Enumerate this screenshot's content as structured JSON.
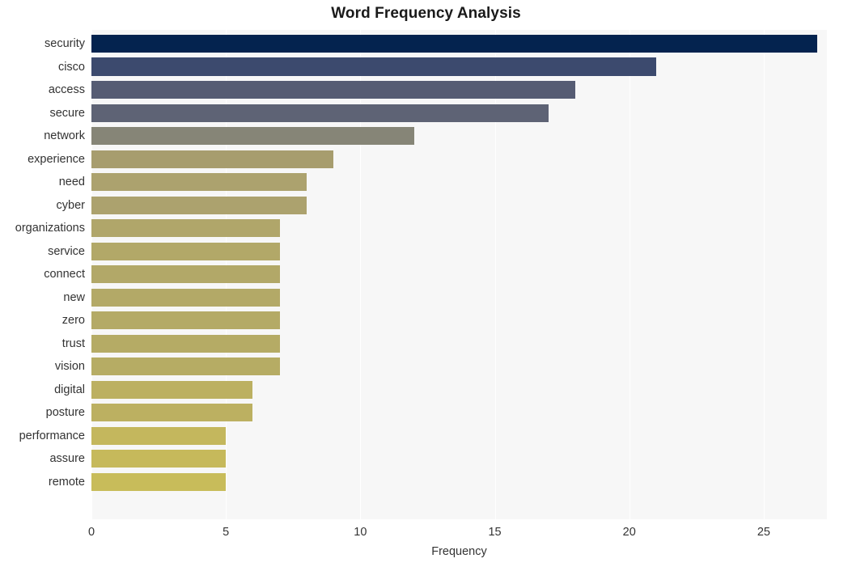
{
  "chart_data": {
    "type": "bar",
    "orientation": "horizontal",
    "title": "Word Frequency Analysis",
    "xlabel": "Frequency",
    "ylabel": "",
    "xlim": [
      0,
      27.35
    ],
    "xticks": [
      0,
      5,
      10,
      15,
      20,
      25
    ],
    "xtick_labels": [
      "0",
      "5",
      "10",
      "15",
      "20",
      "25"
    ],
    "grid": "vertical-white",
    "legend": "none",
    "categories": [
      "security",
      "cisco",
      "access",
      "secure",
      "network",
      "experience",
      "need",
      "cyber",
      "organizations",
      "service",
      "connect",
      "new",
      "zero",
      "trust",
      "vision",
      "digital",
      "posture",
      "performance",
      "assure",
      "remote"
    ],
    "values": [
      27,
      21,
      18,
      17,
      12,
      9,
      8,
      8,
      7,
      7,
      7,
      7,
      7,
      7,
      7,
      6,
      6,
      5,
      5,
      5
    ],
    "bar_colors": [
      "#04234f",
      "#3c4a6e",
      "#565c73",
      "#5e6375",
      "#868577",
      "#a79d6e",
      "#aca26e",
      "#aca26e",
      "#b0a66a",
      "#b2a868",
      "#b2a868",
      "#b3a967",
      "#b4aa66",
      "#b5ab65",
      "#b6ac64",
      "#bcb061",
      "#bcb061",
      "#c4b75d",
      "#c6b95b",
      "#c8bc5a"
    ],
    "plot_background": "#f7f7f7",
    "page_background": "#ffffff",
    "gridline_color": "#ffffff",
    "text_color": "#333333",
    "title_color": "#1a1a1a"
  }
}
